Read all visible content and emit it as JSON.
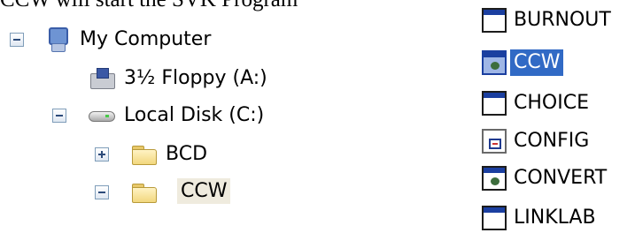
{
  "caption": {
    "text": "CCW will start the SVK Program"
  },
  "tree": {
    "nodes": [
      {
        "label": "My Computer",
        "icon": "my-computer-icon",
        "expander": "collapse"
      },
      {
        "label": "3½ Floppy (A:)",
        "icon": "floppy-drive-icon",
        "expander": "none"
      },
      {
        "label": "Local Disk (C:)",
        "icon": "hard-disk-icon",
        "expander": "collapse"
      },
      {
        "label": "BCD",
        "icon": "folder-icon",
        "expander": "expand"
      },
      {
        "label": "CCW",
        "icon": "folder-open-icon",
        "expander": "collapse",
        "selected": true
      }
    ]
  },
  "file_list": {
    "items": [
      {
        "name": "BURNOUT",
        "icon": "program-window-icon"
      },
      {
        "name": "CCW",
        "icon": "dos-program-icon",
        "selected": true
      },
      {
        "name": "CHOICE",
        "icon": "program-window-icon"
      },
      {
        "name": "CONFIG",
        "icon": "config-file-icon"
      },
      {
        "name": "CONVERT",
        "icon": "dos-program-icon"
      },
      {
        "name": "LINKLAB",
        "icon": "program-window-icon"
      }
    ]
  },
  "colors": {
    "selection": "#316ac5",
    "tree_selection": "#efebde",
    "expander_border": "#7f9db9"
  }
}
